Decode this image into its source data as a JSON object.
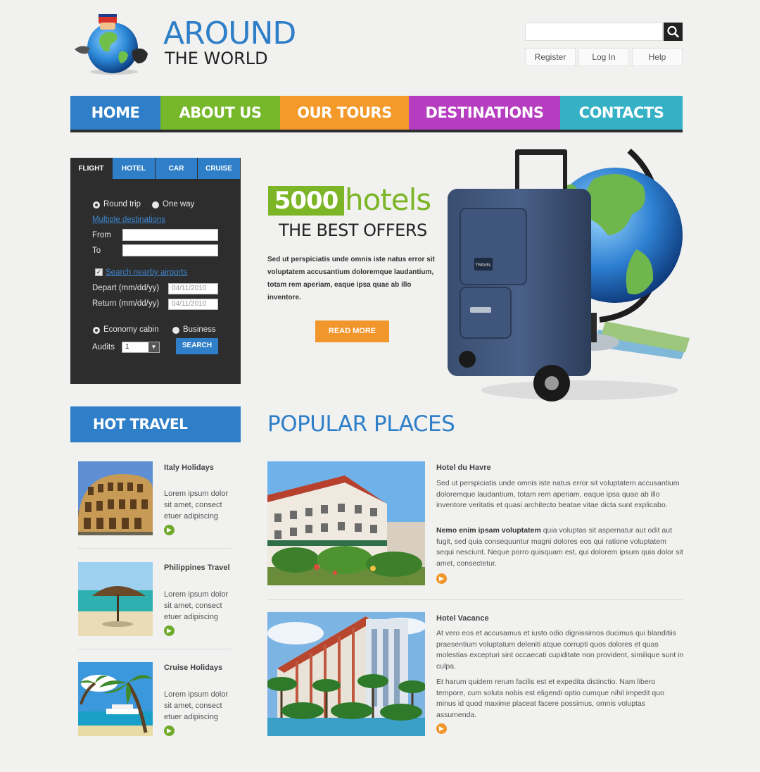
{
  "header": {
    "title": "AROUND",
    "subtitle": "THE WORLD",
    "search": {
      "placeholder": ""
    },
    "links": [
      "Register",
      "Log In",
      "Help"
    ]
  },
  "nav": {
    "items": [
      {
        "label": "HOME",
        "color": "#2e7fc8"
      },
      {
        "label": "ABOUT US",
        "color": "#76b82a"
      },
      {
        "label": "OUR TOURS",
        "color": "#f39a2a"
      },
      {
        "label": "DESTINATIONS",
        "color": "#b63cc0"
      },
      {
        "label": "CONTACTS",
        "color": "#35b1c6"
      }
    ]
  },
  "booking": {
    "tabs": [
      "FLIGHT",
      "HOTEL",
      "CAR",
      "CRUISE"
    ],
    "round_trip": "Round trip",
    "one_way": "One way",
    "multiple": "Multiple destinations",
    "from_label": "From",
    "to_label": "To",
    "nearby": "Search nearby airports",
    "depart_label": "Depart (mm/dd/yy)",
    "depart_value": "04/11/2010",
    "return_label": "Return (mm/dd/yy)",
    "return_value": "04/11/2010",
    "economy": "Economy cabin",
    "business": "Business",
    "adults_label": "Audits",
    "adults_value": "1",
    "search_label": "SEARCH"
  },
  "hero": {
    "badge": "5000",
    "headline": "hotels",
    "subheadline": "THE BEST OFFERS",
    "text": "Sed ut perspiciatis unde omnis iste natus error sit voluptatem accusantium doloremque laudantium, totam rem aperiam, eaque ipsa quae ab illo inventore.",
    "button": "READ MORE",
    "luggage_tag": "TRAVEL"
  },
  "hot_travel": {
    "title": "HOT TRAVEL",
    "items": [
      {
        "title": "Italy Holidays",
        "text": "Lorem ipsum dolor sit amet, consect etuer adipiscing"
      },
      {
        "title": "Philippines Travel",
        "text": "Lorem ipsum dolor sit amet, consect etuer adipiscing"
      },
      {
        "title": "Cruise Holidays",
        "text": "Lorem ipsum dolor sit amet, consect etuer adipiscing"
      }
    ]
  },
  "popular": {
    "title": "POPULAR PLACES",
    "items": [
      {
        "name": "Hotel du Havre",
        "p1": "Sed ut perspiciatis unde omnis iste natus error sit voluptatem accusantium doloremque laudantium, totam rem aperiam, eaque ipsa quae ab illo inventore veritatis et quasi architecto beatae vitae dicta sunt explicabo.",
        "p2_bold": "Nemo enim ipsam voluptatem",
        "p2": " quia voluptas sit aspernatur aut odit aut fugit, sed quia consequuntur magni dolores eos qui ratione voluptatem sequi nesciunt. Neque porro quisquam est, qui dolorem ipsum quia dolor sit amet, consectetur."
      },
      {
        "name": "Hotel Vacance",
        "p1": "At vero eos et accusamus et iusto odio dignissimos ducimus qui blanditiis praesentium voluptatum deleniti atque corrupti quos dolores et quas molestias excepturi sint occaecati cupiditate non provident, similique sunt in culpa.",
        "p2_bold": "",
        "p2": "Et harum quidem rerum facilis est et expedita distinctio. Nam libero tempore, cum soluta nobis est eligendi optio cumque nihil impedit quo minus id quod maxime placeat facere possimus, omnis voluptas assumenda."
      }
    ]
  }
}
